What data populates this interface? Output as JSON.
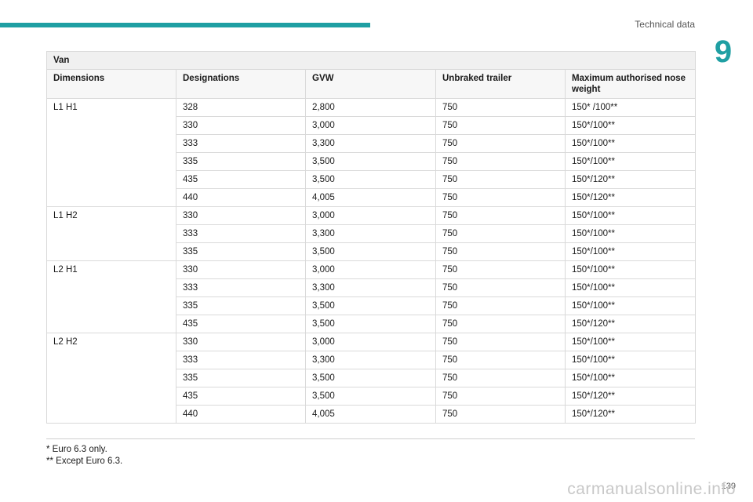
{
  "header": {
    "section": "Technical data",
    "chapter": "9"
  },
  "table": {
    "title": "Van",
    "columns": [
      "Dimensions",
      "Designations",
      "GVW",
      "Unbraked trailer",
      "Maximum authorised nose weight"
    ],
    "groups": [
      {
        "dimension": "L1 H1",
        "rows": [
          [
            "328",
            "2,800",
            "750",
            "150* /100**"
          ],
          [
            "330",
            "3,000",
            "750",
            "150*/100**"
          ],
          [
            "333",
            "3,300",
            "750",
            "150*/100**"
          ],
          [
            "335",
            "3,500",
            "750",
            "150*/100**"
          ],
          [
            "435",
            "3,500",
            "750",
            "150*/120**"
          ],
          [
            "440",
            "4,005",
            "750",
            "150*/120**"
          ]
        ]
      },
      {
        "dimension": "L1 H2",
        "rows": [
          [
            "330",
            "3,000",
            "750",
            "150*/100**"
          ],
          [
            "333",
            "3,300",
            "750",
            "150*/100**"
          ],
          [
            "335",
            "3,500",
            "750",
            "150*/100**"
          ]
        ]
      },
      {
        "dimension": "L2 H1",
        "rows": [
          [
            "330",
            "3,000",
            "750",
            "150*/100**"
          ],
          [
            "333",
            "3,300",
            "750",
            "150*/100**"
          ],
          [
            "335",
            "3,500",
            "750",
            "150*/100**"
          ],
          [
            "435",
            "3,500",
            "750",
            "150*/120**"
          ]
        ]
      },
      {
        "dimension": "L2 H2",
        "rows": [
          [
            "330",
            "3,000",
            "750",
            "150*/100**"
          ],
          [
            "333",
            "3,300",
            "750",
            "150*/100**"
          ],
          [
            "335",
            "3,500",
            "750",
            "150*/100**"
          ],
          [
            "435",
            "3,500",
            "750",
            "150*/120**"
          ],
          [
            "440",
            "4,005",
            "750",
            "150*/120**"
          ]
        ]
      }
    ]
  },
  "footnotes": [
    "* Euro 6.3 only.",
    "** Except Euro 6.3."
  ],
  "page_number": "139",
  "watermark": "carmanualsonline.info",
  "colors": {
    "accent": "#1f9fa3",
    "border": "#d9d9d9"
  }
}
